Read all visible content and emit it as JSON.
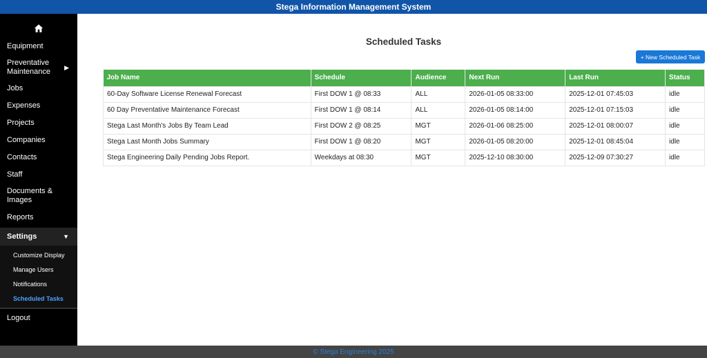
{
  "app": {
    "title": "Stega Information Management System"
  },
  "sidebar": {
    "items": [
      {
        "label": "Equipment"
      },
      {
        "label": "Preventative Maintenance"
      },
      {
        "label": "Jobs"
      },
      {
        "label": "Expenses"
      },
      {
        "label": "Projects"
      },
      {
        "label": "Companies"
      },
      {
        "label": "Contacts"
      },
      {
        "label": "Staff"
      },
      {
        "label": "Documents & Images"
      },
      {
        "label": "Reports"
      }
    ],
    "settings": {
      "label": "Settings",
      "subitems": [
        {
          "label": "Customize Display"
        },
        {
          "label": "Manage Users"
        },
        {
          "label": "Notifications"
        },
        {
          "label": "Scheduled Tasks",
          "active": true
        }
      ]
    },
    "logout": "Logout",
    "icons": {
      "home": "home-icon",
      "expand": "caret-right-icon",
      "collapse": "caret-down-icon"
    }
  },
  "main": {
    "title": "Scheduled Tasks",
    "new_button": "+ New Scheduled Task",
    "table": {
      "headers": [
        "Job Name",
        "Schedule",
        "Audience",
        "Next Run",
        "Last Run",
        "Status"
      ],
      "rows": [
        [
          "60-Day Software License Renewal Forecast",
          "First DOW 1 @ 08:33",
          "ALL",
          "2026-01-05 08:33:00",
          "2025-12-01 07:45:03",
          "idle"
        ],
        [
          "60 Day Preventative Maintenance Forecast",
          "First DOW 1 @ 08:14",
          "ALL",
          "2026-01-05 08:14:00",
          "2025-12-01 07:15:03",
          "idle"
        ],
        [
          "Stega Last Month's Jobs By Team Lead",
          "First DOW 2 @ 08:25",
          "MGT",
          "2026-01-06 08:25:00",
          "2025-12-01 08:00:07",
          "idle"
        ],
        [
          "Stega Last Month Jobs Summary",
          "First DOW 1 @ 08:20",
          "MGT",
          "2026-01-05 08:20:00",
          "2025-12-01 08:45:04",
          "idle"
        ],
        [
          "Stega Engineering Daily Pending Jobs Report.",
          "Weekdays at 08:30",
          "MGT",
          "2025-12-10 08:30:00",
          "2025-12-09 07:30:27",
          "idle"
        ]
      ]
    }
  },
  "footer": {
    "text": "© Stega Engineering 2025"
  },
  "colors": {
    "topbar": "#1155a8",
    "header_green": "#4cae4c",
    "button_blue": "#1a78d6",
    "active_link": "#4aa3ff",
    "footer_bg": "#444444"
  }
}
